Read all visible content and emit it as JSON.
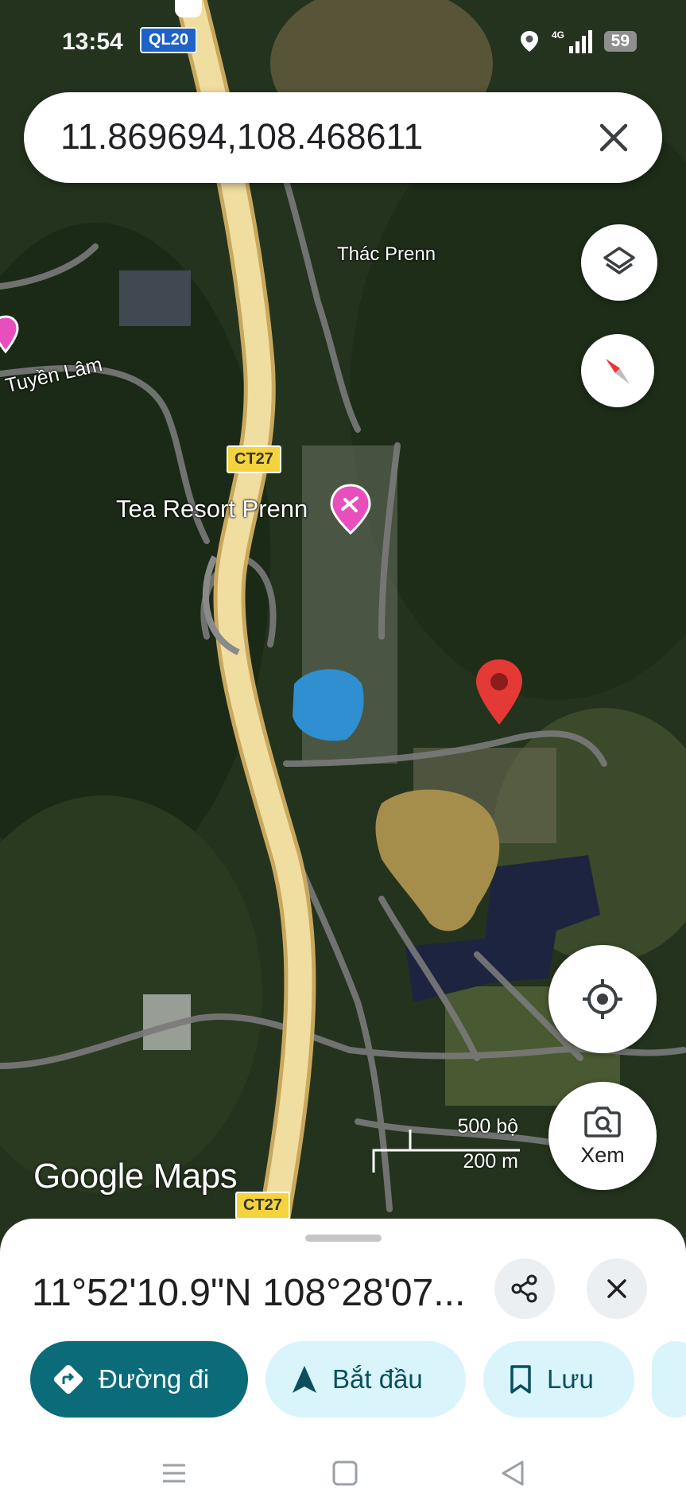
{
  "status_bar": {
    "time": "13:54",
    "route_badge": "QL20",
    "network": "4G",
    "battery": "59"
  },
  "search": {
    "query": "11.869694,108.468611"
  },
  "map": {
    "labels": {
      "waterfall": "Thác Prenn",
      "road_west": "Tuyền Lâm",
      "resort": "Tea Resort Prenn"
    },
    "road_shields": [
      "CT27",
      "CT27"
    ],
    "scale": {
      "imperial": "500 bộ",
      "metric": "200 m"
    },
    "brand": "Google Maps",
    "view_button": "Xem"
  },
  "sheet": {
    "coordinates": "11°52'10.9\"N 108°28'07...",
    "actions": [
      {
        "label": "Đường đi",
        "icon": "directions-icon"
      },
      {
        "label": "Bắt đầu",
        "icon": "navigation-arrow-icon"
      },
      {
        "label": "Lưu",
        "icon": "bookmark-icon"
      }
    ]
  },
  "colors": {
    "primary": "#0b6b78",
    "chip_secondary": "#d9f4fb",
    "pin": "#e53935",
    "resort_pin": "#e84fbd"
  }
}
